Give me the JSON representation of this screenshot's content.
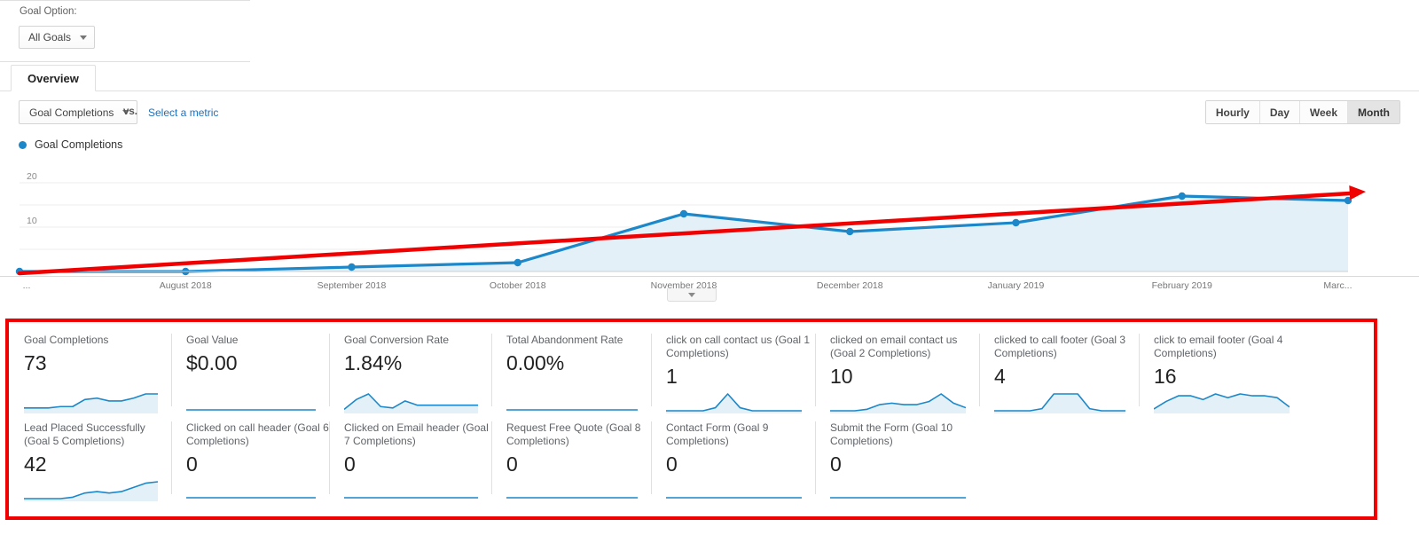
{
  "goal_option": {
    "label": "Goal Option:",
    "selected": "All Goals"
  },
  "tabs": [
    {
      "label": "Overview",
      "active": true
    }
  ],
  "metric_selector": {
    "primary_metric": "Goal Completions",
    "vs_text": "vs.",
    "compare_link": "Select a metric"
  },
  "granularity": {
    "options": [
      "Hourly",
      "Day",
      "Week",
      "Month"
    ],
    "selected": "Month"
  },
  "legend": {
    "series_label": "Goal Completions",
    "color": "#1c87c9"
  },
  "collapse_handle": {
    "icon": "chevron-down-icon"
  },
  "annotation": {
    "box_color": "#f00000",
    "trend_arrow_color": "#f00000"
  },
  "chart_data": {
    "type": "line",
    "title": "Goal Completions",
    "xlabel": "",
    "ylabel": "",
    "ylim": [
      0,
      24
    ],
    "yticks": [
      10,
      20
    ],
    "grid": true,
    "legend_position": "top-left",
    "area_fill": "#e3f0f7",
    "line_color": "#1c87c9",
    "x": [
      "...",
      "August 2018",
      "September 2018",
      "October 2018",
      "November 2018",
      "December 2018",
      "January 2019",
      "February 2019",
      "Marc..."
    ],
    "categories": [
      "...",
      "August 2018",
      "September 2018",
      "October 2018",
      "November 2018",
      "December 2018",
      "January 2019",
      "February 2019",
      "Marc..."
    ],
    "values": [
      0,
      0,
      1,
      2,
      13,
      9,
      11,
      17,
      16
    ],
    "series": [
      {
        "name": "Goal Completions",
        "values": [
          0,
          0,
          1,
          2,
          13,
          9,
          11,
          17,
          16
        ]
      }
    ],
    "annotations": [
      {
        "type": "arrow",
        "label": "upward trend arrow",
        "color": "#f00000",
        "from": [
          0,
          0
        ],
        "to": [
          9,
          17
        ]
      }
    ]
  },
  "metric_cards": [
    {
      "title": "Goal Completions",
      "value": "73",
      "spark": [
        2,
        2,
        2,
        3,
        3,
        8,
        9,
        7,
        7,
        9,
        12,
        12
      ],
      "flat": false
    },
    {
      "title": "Goal Value",
      "value": "$0.00",
      "spark": [
        0,
        0,
        0,
        0,
        0,
        0,
        0,
        0,
        0,
        0,
        0,
        0
      ],
      "flat": true
    },
    {
      "title": "Goal Conversion Rate",
      "value": "1.84%",
      "spark": [
        1,
        8,
        12,
        3,
        2,
        7,
        4,
        4,
        4,
        4,
        4,
        4
      ],
      "flat": false
    },
    {
      "title": "Total Abandonment Rate",
      "value": "0.00%",
      "spark": [
        0,
        0,
        0,
        0,
        0,
        0,
        0,
        0,
        0,
        0,
        0,
        0
      ],
      "flat": true
    },
    {
      "title": "click on call contact us (Goal 1 Completions)",
      "value": "1",
      "spark": [
        0,
        0,
        0,
        0,
        2,
        11,
        2,
        0,
        0,
        0,
        0,
        0
      ],
      "flat": false
    },
    {
      "title": "clicked on email contact us (Goal 2 Completions)",
      "value": "10",
      "spark": [
        0,
        0,
        0,
        1,
        4,
        5,
        4,
        4,
        6,
        11,
        5,
        2
      ],
      "flat": false
    },
    {
      "title": "clicked to call footer (Goal 3 Completions)",
      "value": "4",
      "spark": [
        0,
        0,
        0,
        0,
        1,
        8,
        8,
        8,
        1,
        0,
        0,
        0
      ],
      "flat": false
    },
    {
      "title": "click to email footer (Goal 4 Completions)",
      "value": "16",
      "spark": [
        1,
        5,
        8,
        8,
        6,
        9,
        7,
        9,
        8,
        8,
        7,
        2
      ],
      "flat": false
    },
    {
      "title": "Lead Placed Successfully (Goal 5 Completions)",
      "value": "42",
      "spark": [
        0,
        0,
        0,
        0,
        1,
        4,
        5,
        4,
        5,
        8,
        11,
        12
      ],
      "flat": false
    },
    {
      "title": "Clicked on call header (Goal 6 Completions)",
      "value": "0",
      "spark": [
        0,
        0,
        0,
        0,
        0,
        0,
        0,
        0,
        0,
        0,
        0,
        0
      ],
      "flat": true
    },
    {
      "title": "Clicked on Email header (Goal 7 Completions)",
      "value": "0",
      "spark": [
        0,
        0,
        0,
        0,
        0,
        0,
        0,
        0,
        0,
        0,
        0,
        0
      ],
      "flat": true
    },
    {
      "title": "Request Free Quote (Goal 8 Completions)",
      "value": "0",
      "spark": [
        0,
        0,
        0,
        0,
        0,
        0,
        0,
        0,
        0,
        0,
        0,
        0
      ],
      "flat": true
    },
    {
      "title": "Contact Form (Goal 9 Completions)",
      "value": "0",
      "spark": [
        0,
        0,
        0,
        0,
        0,
        0,
        0,
        0,
        0,
        0,
        0,
        0
      ],
      "flat": true
    },
    {
      "title": "Submit the Form (Goal 10 Completions)",
      "value": "0",
      "spark": [
        0,
        0,
        0,
        0,
        0,
        0,
        0,
        0,
        0,
        0,
        0,
        0
      ],
      "flat": true
    }
  ]
}
